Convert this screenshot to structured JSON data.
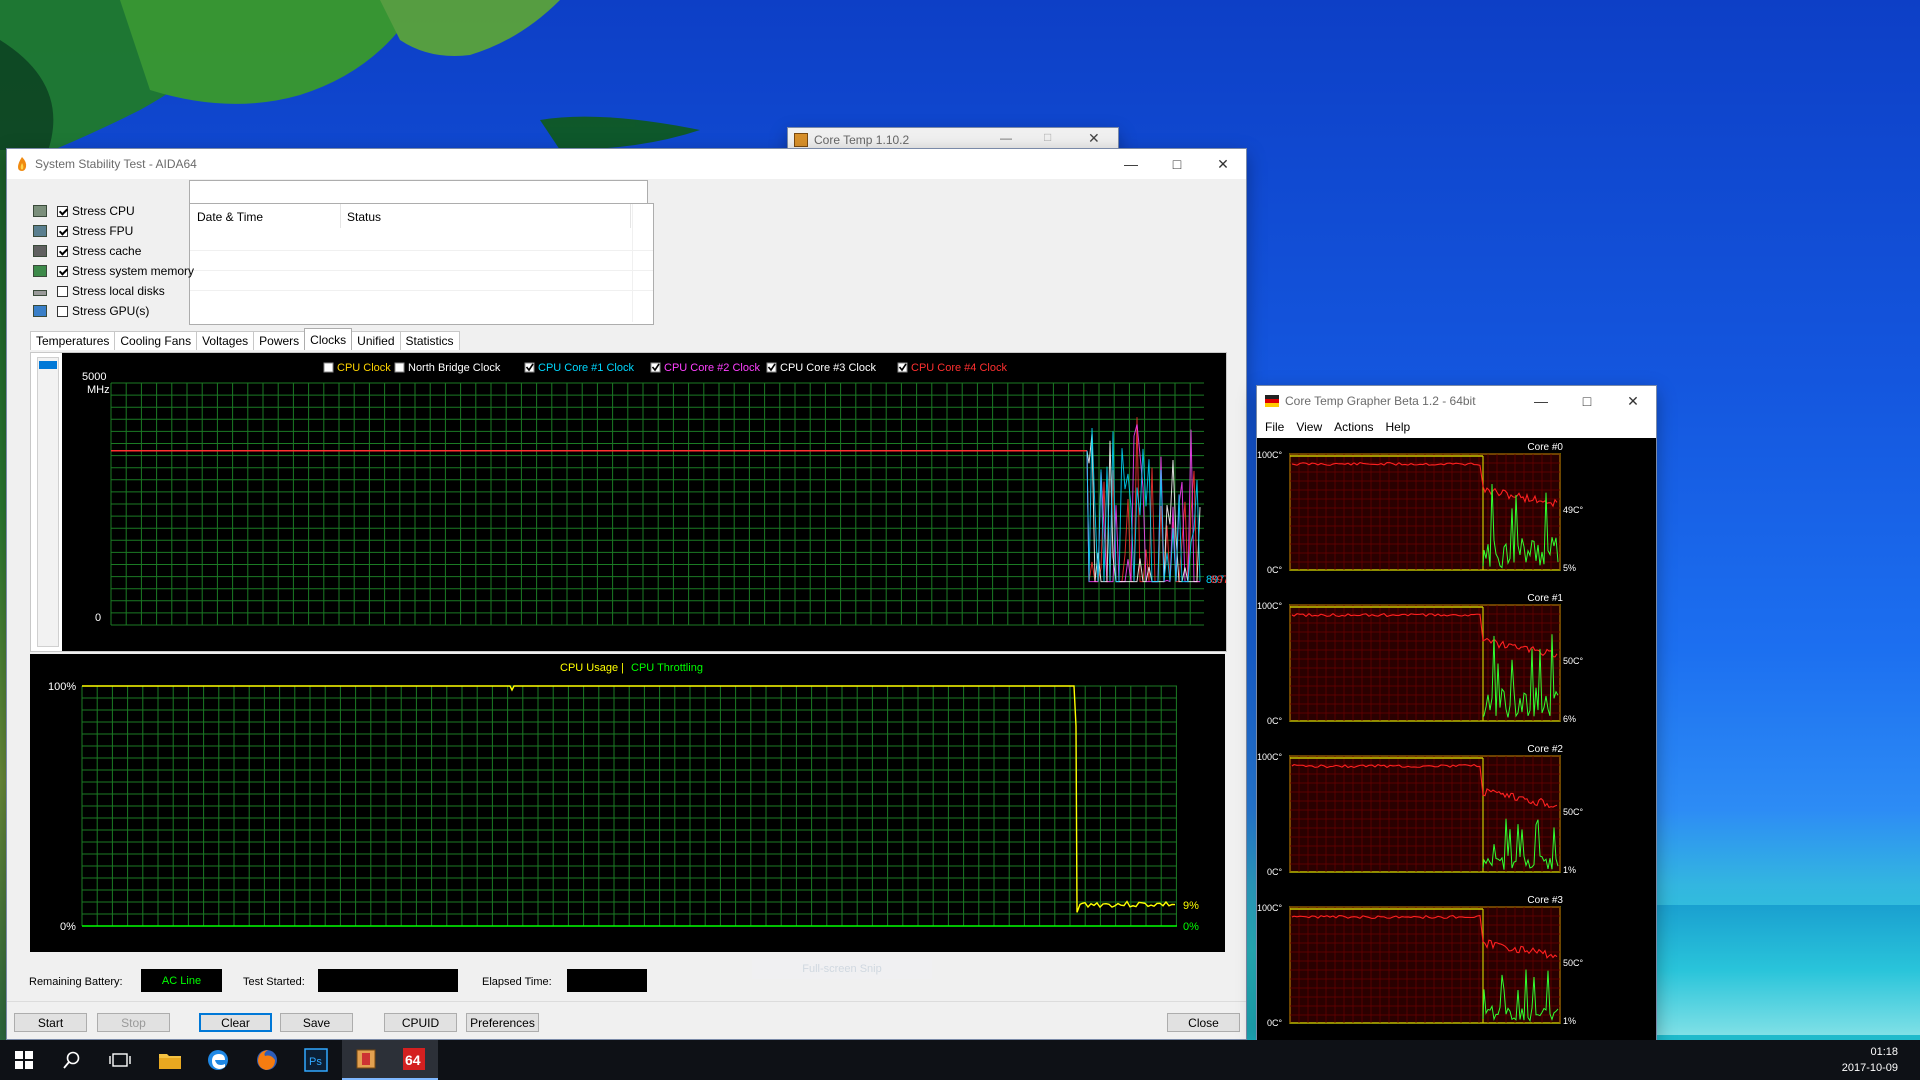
{
  "aida": {
    "title": "System Stability Test - AIDA64",
    "stress": [
      {
        "label": "Stress CPU",
        "checked": true
      },
      {
        "label": "Stress FPU",
        "checked": true
      },
      {
        "label": "Stress cache",
        "checked": true
      },
      {
        "label": "Stress system memory",
        "checked": true
      },
      {
        "label": "Stress local disks",
        "checked": false
      },
      {
        "label": "Stress GPU(s)",
        "checked": false
      }
    ],
    "log_headers": {
      "datetime": "Date & Time",
      "status": "Status"
    },
    "tabs": [
      "Temperatures",
      "Cooling Fans",
      "Voltages",
      "Powers",
      "Clocks",
      "Unified",
      "Statistics"
    ],
    "active_tab": "Clocks",
    "clock_legend": [
      {
        "label": "CPU Clock",
        "checked": false,
        "color": "#ffd400"
      },
      {
        "label": "North Bridge Clock",
        "checked": false,
        "color": "#ffffff"
      },
      {
        "label": "CPU Core #1 Clock",
        "checked": true,
        "color": "#00d8ff"
      },
      {
        "label": "CPU Core #2 Clock",
        "checked": true,
        "color": "#ff40ff"
      },
      {
        "label": "CPU Core #3 Clock",
        "checked": true,
        "color": "#ffffff"
      },
      {
        "label": "CPU Core #4 Clock",
        "checked": true,
        "color": "#ff3030"
      }
    ],
    "clock_axis": {
      "max": "5000",
      "unit": "MHz",
      "min": "0"
    },
    "clock_readouts": [
      "897",
      "897"
    ],
    "usage_legend": {
      "usage": "CPU Usage",
      "sep": "|",
      "throttle": "CPU Throttling"
    },
    "usage_axis": {
      "max": "100%",
      "min": "0%"
    },
    "usage_readouts": {
      "usage": "9%",
      "throttle": "0%"
    },
    "status": {
      "battery_label": "Remaining Battery:",
      "battery_value": "AC Line",
      "started_label": "Test Started:",
      "elapsed_label": "Elapsed Time:"
    },
    "buttons": {
      "start": "Start",
      "stop": "Stop",
      "clear": "Clear",
      "save": "Save",
      "cpuid": "CPUID",
      "prefs": "Preferences",
      "close": "Close"
    },
    "snip_hint": "Full-screen Snip"
  },
  "coretemp": {
    "title": "Core Temp 1.10.2"
  },
  "grapher": {
    "title": "Core Temp Grapher Beta 1.2 - 64bit",
    "menu": [
      "File",
      "View",
      "Actions",
      "Help"
    ],
    "cores": [
      {
        "name": "Core #0",
        "top": "100C°",
        "bottom": "0C°",
        "temp": "49C°",
        "load": "5%"
      },
      {
        "name": "Core #1",
        "top": "100C°",
        "bottom": "0C°",
        "temp": "50C°",
        "load": "6%"
      },
      {
        "name": "Core #2",
        "top": "100C°",
        "bottom": "0C°",
        "temp": "50C°",
        "load": "1%"
      },
      {
        "name": "Core #3",
        "top": "100C°",
        "bottom": "0C°",
        "temp": "50C°",
        "load": "1%"
      }
    ]
  },
  "taskbar": {
    "time": "01:18",
    "date": "2017-10-09"
  },
  "chart_data": [
    {
      "type": "line",
      "title": "",
      "ylabel": "MHz",
      "ylim": [
        0,
        5000
      ],
      "series": [
        {
          "name": "CPU Core #1 Clock",
          "baseline": 3600,
          "current": 897
        },
        {
          "name": "CPU Core #4 Clock",
          "baseline": 3600,
          "current": 897
        }
      ]
    },
    {
      "type": "line",
      "ylim": [
        0,
        100
      ],
      "series": [
        {
          "name": "CPU Usage",
          "baseline": 100,
          "current": 9
        },
        {
          "name": "CPU Throttling",
          "current": 0
        }
      ]
    }
  ]
}
